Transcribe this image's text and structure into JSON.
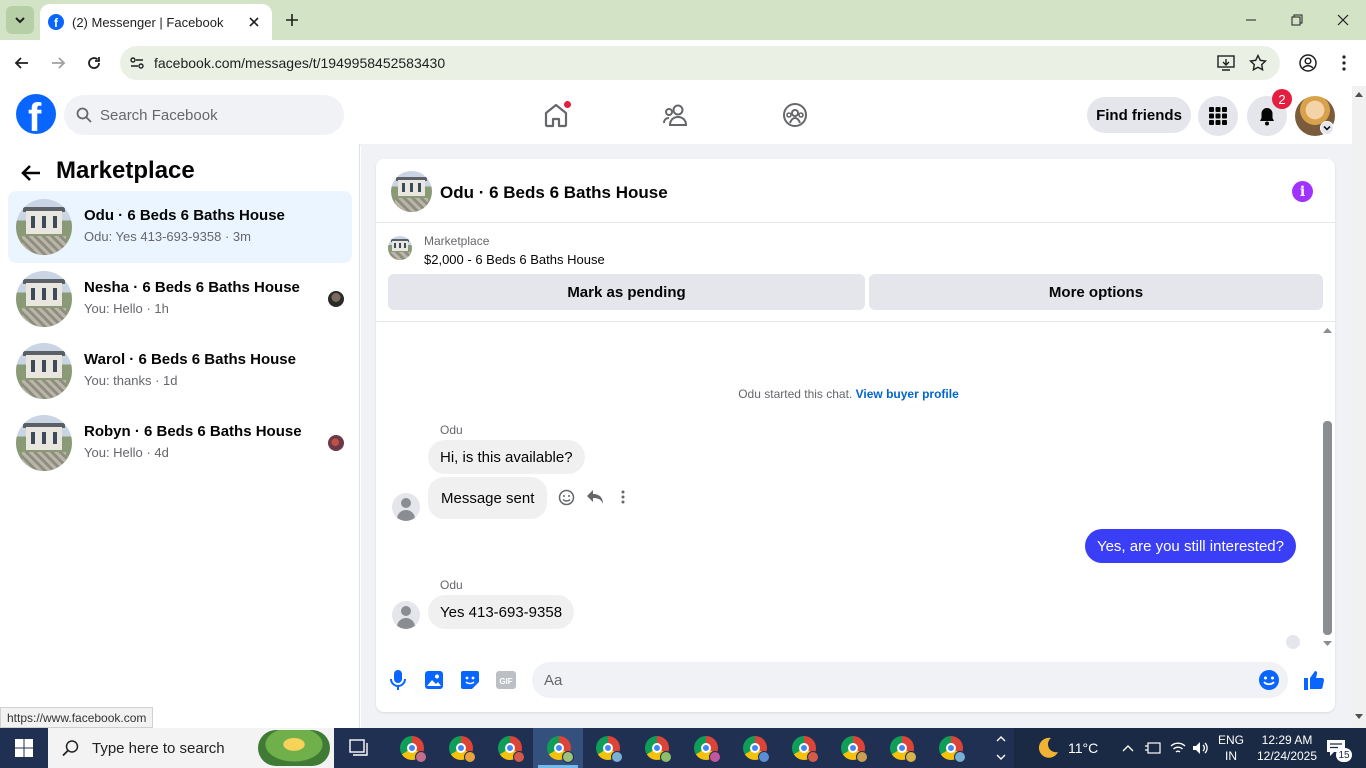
{
  "browser": {
    "tab_title": "(2) Messenger | Facebook",
    "url": "facebook.com/messages/t/1949958452583430",
    "status_url": "https://www.facebook.com"
  },
  "fb_header": {
    "logo_letter": "f",
    "search_placeholder": "Search Facebook",
    "find_friends_label": "Find friends",
    "notifications_count": "2"
  },
  "left_panel": {
    "title": "Marketplace",
    "conversations": [
      {
        "name": "Odu · 6 Beds 6 Baths House",
        "snippet": "Odu: Yes 413-693-9358 · 3m",
        "active": true
      },
      {
        "name": "Nesha · 6 Beds 6 Baths House",
        "snippet": "You: Hello · 1h",
        "active": false
      },
      {
        "name": "Warol · 6 Beds 6 Baths House",
        "snippet": "You: thanks · 1d",
        "active": false
      },
      {
        "name": "Robyn · 6 Beds 6 Baths House",
        "snippet": "You: Hello · 4d",
        "active": false
      }
    ]
  },
  "chat": {
    "title": "Odu · 6 Beds 6 Baths House",
    "info_glyph": "i",
    "listing_source": "Marketplace",
    "listing_price_title": "$2,000 - 6 Beds 6 Baths House",
    "mark_pending_label": "Mark as pending",
    "more_options_label": "More options",
    "started_text": "Odu started this chat.",
    "view_profile_label": "View buyer profile",
    "messages": [
      {
        "sender": "Odu",
        "text": "Hi, is this available?"
      },
      {
        "text": "Message sent"
      },
      {
        "text": "Yes, are you still interested?"
      },
      {
        "sender": "Odu",
        "text": "Yes 413-693-9358"
      }
    ],
    "composer_placeholder": "Aa",
    "accent_color": "#0866ff",
    "outgoing_bubble_color": "#3a3ff7"
  },
  "taskbar": {
    "search_placeholder": "Type here to search",
    "weather": "11°C",
    "language": "ENG",
    "region": "IN",
    "time": "12:29 AM",
    "date": "12/24/2025",
    "notification_count": "15"
  }
}
